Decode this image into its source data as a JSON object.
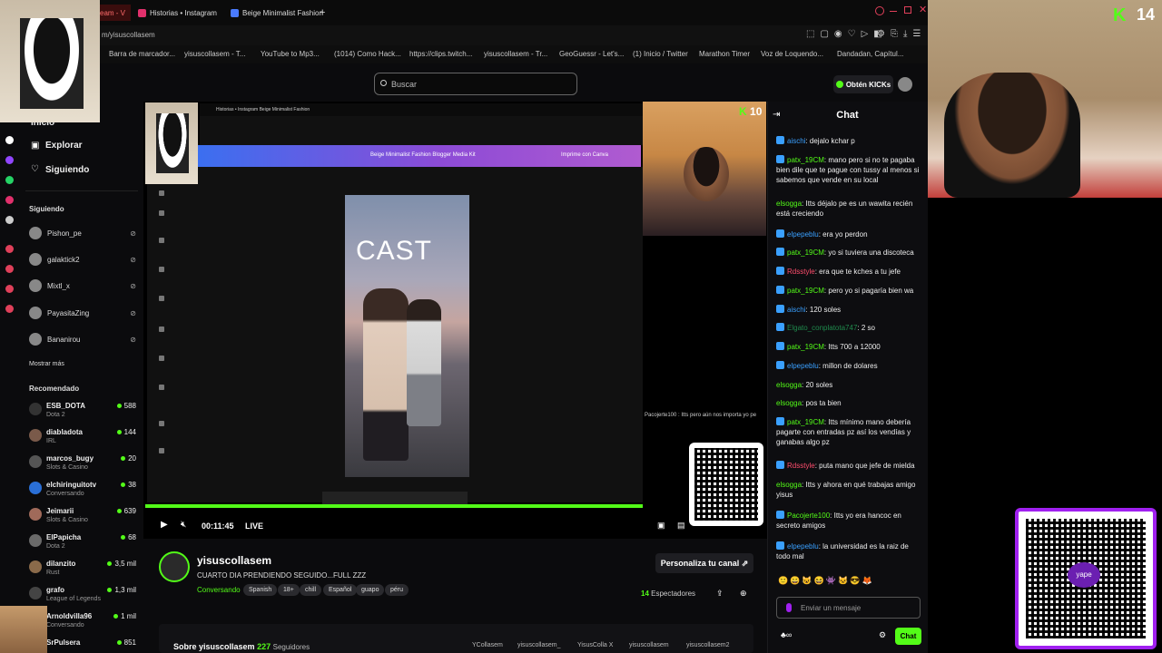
{
  "browser": {
    "tabs": [
      {
        "label": "eam - V",
        "color": "#ff3b3b"
      },
      {
        "label": "Historias • Instagram",
        "color": "#e1306c"
      },
      {
        "label": "Beige Minimalist Fashion",
        "color": "#4a7bff"
      }
    ],
    "new_tab": "+",
    "address": "m/yisuscollasem",
    "bookmarks": [
      "Barra de marcador...",
      "yisuscollasem - T...",
      "YouTube to Mp3...",
      "(1014) Como Hack...",
      "https://clips.twitch...",
      "yisuscollasem - Tr...",
      "GeoGuessr - Let's...",
      "(1) Inicio / Twitter",
      "Marathon Timer",
      "Voz de Loquendo...",
      "Dandadan, Capítul..."
    ]
  },
  "header": {
    "search_placeholder": "Buscar",
    "kicks_button": "Obtén KICKs"
  },
  "sidebar": {
    "nav": [
      "Inicio",
      "Explorar",
      "Siguiendo"
    ],
    "following_title": "Siguiendo",
    "following": [
      "Pishon_pe",
      "galaktick2",
      "Mixtl_x",
      "PayasitaZing",
      "Bananirou"
    ],
    "show_more": "Mostrar más",
    "recommended_title": "Recomendado",
    "recommended": [
      {
        "name": "ESB_DOTA",
        "category": "Dota 2",
        "viewers": "588"
      },
      {
        "name": "diabladota",
        "category": "IRL",
        "viewers": "144"
      },
      {
        "name": "marcos_bugy",
        "category": "Slots & Casino",
        "viewers": "20"
      },
      {
        "name": "elchiringuitotv",
        "category": "Conversando",
        "viewers": "38"
      },
      {
        "name": "Jeimarii",
        "category": "Slots & Casino",
        "viewers": "639"
      },
      {
        "name": "ElPapicha",
        "category": "Dota 2",
        "viewers": "68"
      },
      {
        "name": "dilanzito",
        "category": "Rust",
        "viewers": "3,5 mil"
      },
      {
        "name": "grafo",
        "category": "League of Legends",
        "viewers": "1,3 mil"
      },
      {
        "name": "Arnoldvilla96",
        "category": "Conversando",
        "viewers": "1 mil"
      },
      {
        "name": "SrPulsera",
        "category": "",
        "viewers": "851"
      }
    ]
  },
  "player": {
    "inner_tabs": "Historias • Instagram   Beige Minimalist Fashion",
    "editor_title": "Beige Minimalist Fashion Blogger Media Kit",
    "editor_btn": "Imprime con Canva",
    "canvas_text": "CAST",
    "time": "00:11:45",
    "live": "LIVE",
    "webcam_viewers": "10",
    "overlay_chat": "Pacojerte100 : Itts pero aún nos importa yo pe"
  },
  "chat": {
    "title": "Chat",
    "messages": [
      {
        "user": "aischi",
        "color": "#3aa0ff",
        "text": "dejalo kchar p",
        "badge": true
      },
      {
        "user": "patx_19CM",
        "color": "#53fc18",
        "text": "mano pero si no te pagaba bien dile que te pague con tussy al menos si sabemos que vende en su local",
        "badge": true
      },
      {
        "user": "elsogga",
        "color": "#53fc18",
        "text": "Itts déjalo pe es un wawita recién está creciendo",
        "badge": false
      },
      {
        "user": "elpepeblu",
        "color": "#3aa0ff",
        "text": "era yo perdon",
        "badge": true
      },
      {
        "user": "patx_19CM",
        "color": "#53fc18",
        "text": "yo si tuviera una discoteca",
        "badge": true
      },
      {
        "user": "Rdsstyle",
        "color": "#ff4d6d",
        "text": "era que te kches a tu jefe",
        "badge": true
      },
      {
        "user": "patx_19CM",
        "color": "#53fc18",
        "text": "pero yo si pagaría bien wa",
        "badge": true
      },
      {
        "user": "aischi",
        "color": "#3aa0ff",
        "text": "120 soles",
        "badge": true
      },
      {
        "user": "Elgato_conplatota747",
        "color": "#1f8a4c",
        "text": "2 so",
        "badge": true
      },
      {
        "user": "patx_19CM",
        "color": "#53fc18",
        "text": "Itts 700 a 12000",
        "badge": true
      },
      {
        "user": "elpepeblu",
        "color": "#3aa0ff",
        "text": "millon de dolares",
        "badge": true
      },
      {
        "user": "elsogga",
        "color": "#53fc18",
        "text": "20 soles",
        "badge": false
      },
      {
        "user": "elsogga",
        "color": "#53fc18",
        "text": "pos ta bien",
        "badge": false
      },
      {
        "user": "patx_19CM",
        "color": "#53fc18",
        "text": "Itts mínimo mano debería pagarte con entradas pz así los vendías y ganabas algo pz",
        "badge": true
      },
      {
        "user": "Rdsstyle",
        "color": "#ff4d6d",
        "text": "puta mano que jefe de mielda",
        "badge": true
      },
      {
        "user": "elsogga",
        "color": "#53fc18",
        "text": "Itts y ahora en qué trabajas amigo yisus",
        "badge": false
      },
      {
        "user": "Pacojerte100",
        "color": "#53fc18",
        "text": "Itts yo era hancoc en secreto amigos",
        "badge": true
      },
      {
        "user": "elpepeblu",
        "color": "#3aa0ff",
        "text": "la universidad es la raiz de todo mal",
        "badge": true
      }
    ],
    "input_placeholder": "Enviar un mensaje",
    "send_label": "Chat"
  },
  "channel": {
    "name": "yisuscollasem",
    "title": "CUARTO DIA PRENDIENDO SEGUIDO...FULL ZZZ",
    "category": "Conversando",
    "tags": [
      "Spanish",
      "18+",
      "chill",
      "Español",
      "guapo",
      "péru"
    ],
    "customize": "Personaliza tu canal",
    "viewers_count": "14",
    "viewers_label": "Espectadores",
    "about_label": "Sobre yisuscollasem",
    "followers_count": "227",
    "followers_label": "Seguidores",
    "socials": [
      "YCollasem",
      "yisuscollasem_",
      "YisusColla X",
      "yisuscollasem",
      "yisuscollasem2"
    ]
  },
  "overlay": {
    "k_logo": "K",
    "k_count": "14",
    "yape_label": "yape"
  }
}
